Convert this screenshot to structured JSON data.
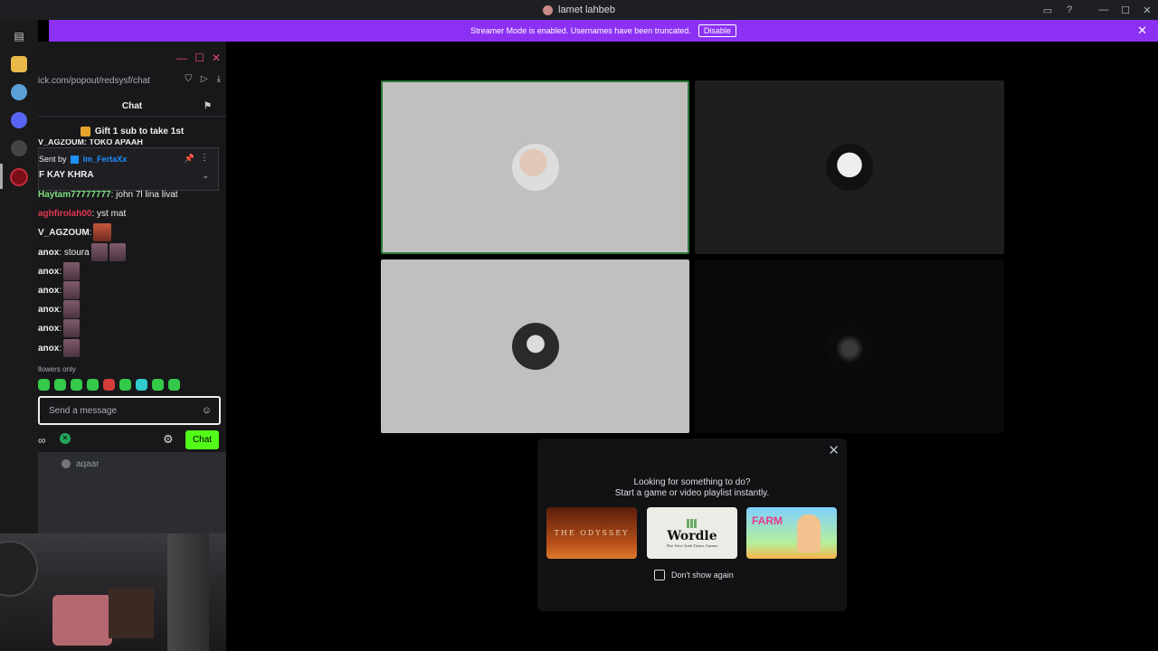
{
  "window": {
    "title": "lamet lahbeb"
  },
  "banner": {
    "text": "Streamer Mode is enabled. Usernames have been truncated.",
    "disable_label": "Disable"
  },
  "chat": {
    "url": "ick.com/popout/redsysf/chat",
    "header": "Chat",
    "gift_banner": "Gift 1 sub to take 1st",
    "clipped_line": "V_AGZOUM: TOKO APAAH",
    "pinned": {
      "sent_by_label": "Sent by",
      "sent_by_user": "lm_FertaXx",
      "text": "F KAY KHRA"
    },
    "messages": [
      {
        "user": "Haytam77777777",
        "user_color": "#7ee07e",
        "text": ": john 7l lina livat"
      },
      {
        "user": "aghfirolah00",
        "user_color": "#e0384f",
        "text": ": yst mat"
      },
      {
        "user": "V_AGZOUM",
        "user_color": "#efeff1",
        "text": ":"
      },
      {
        "user": "anox",
        "user_color": "#efeff1",
        "text": ": stoura"
      },
      {
        "user": "anox",
        "user_color": "#efeff1",
        "text": ":"
      },
      {
        "user": "anox",
        "user_color": "#efeff1",
        "text": ":"
      },
      {
        "user": "anox",
        "user_color": "#efeff1",
        "text": ":"
      },
      {
        "user": "anox",
        "user_color": "#efeff1",
        "text": ":"
      },
      {
        "user": "anox",
        "user_color": "#efeff1",
        "text": ":"
      }
    ],
    "followers_only": "llowers only",
    "input_placeholder": "Send a message",
    "chat_button": "Chat"
  },
  "voice": {
    "channel_user": "aqaar"
  },
  "popup": {
    "line1": "Looking for something to do?",
    "line2": "Start a game or video playlist instantly.",
    "cards": {
      "odyssey": "THE ODYSSEY",
      "wordle": "Wordle",
      "wordle_sub": "The New York Times Games",
      "farm": "FARM"
    },
    "checkbox_label": "Don't show again"
  },
  "colors": {
    "banner": "#8c31f4",
    "chat_button": "#53fc18",
    "active_border": "#2c7a36"
  }
}
